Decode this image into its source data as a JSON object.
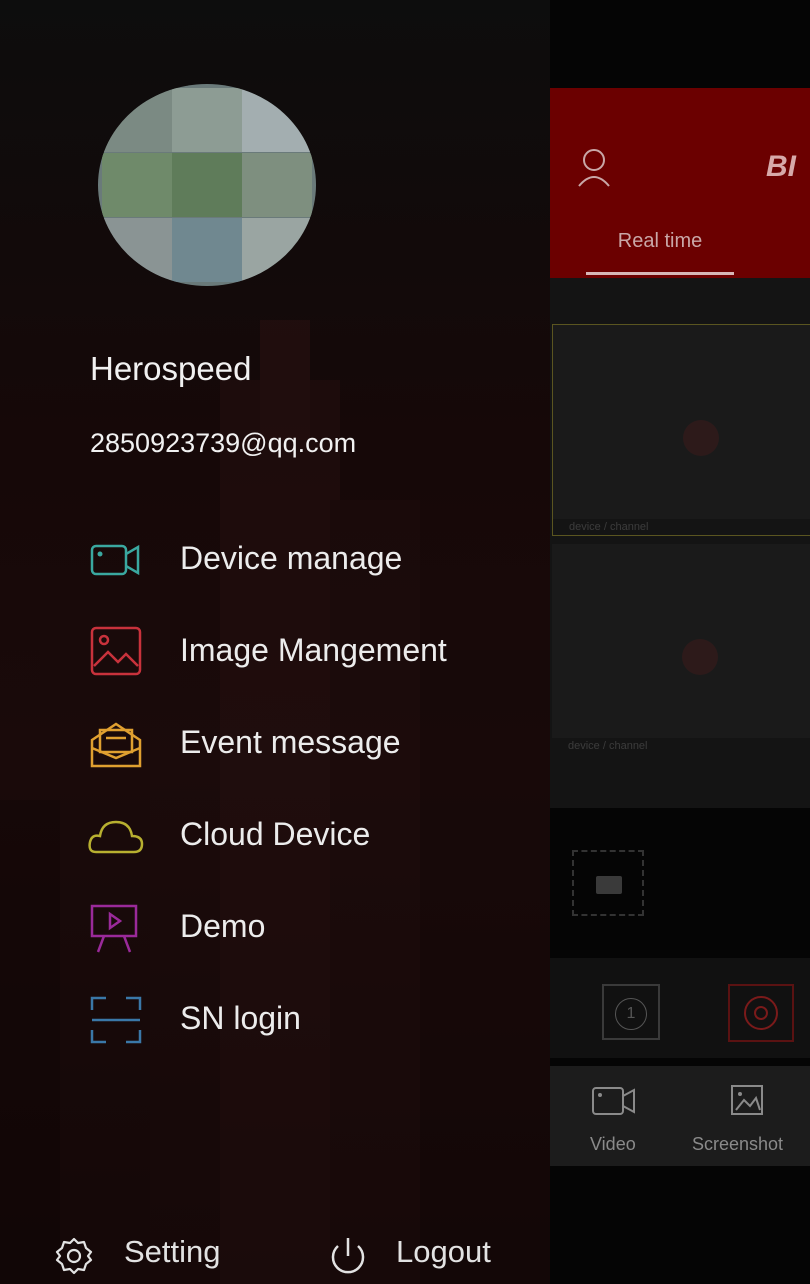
{
  "profile": {
    "username": "Herospeed",
    "email": "2850923739@qq.com"
  },
  "menu": [
    {
      "label": "Device manage",
      "icon": "camera-icon",
      "color": "#3aa8a0"
    },
    {
      "label": "Image Mangement",
      "icon": "image-icon",
      "color": "#c8323c"
    },
    {
      "label": "Event message",
      "icon": "mail-icon",
      "color": "#e0a030"
    },
    {
      "label": "Cloud Device",
      "icon": "cloud-icon",
      "color": "#b8b030"
    },
    {
      "label": "Demo",
      "icon": "presentation-icon",
      "color": "#9a2a9a"
    },
    {
      "label": "SN login",
      "icon": "scan-icon",
      "color": "#3a78a8"
    }
  ],
  "footer": {
    "setting_label": "Setting",
    "logout_label": "Logout"
  },
  "background_app": {
    "brand": "BI",
    "tab_label": "Real time",
    "panel_caption": "device / channel",
    "channel_number": "1",
    "video_label": "Video",
    "screenshot_label": "Screenshot"
  }
}
